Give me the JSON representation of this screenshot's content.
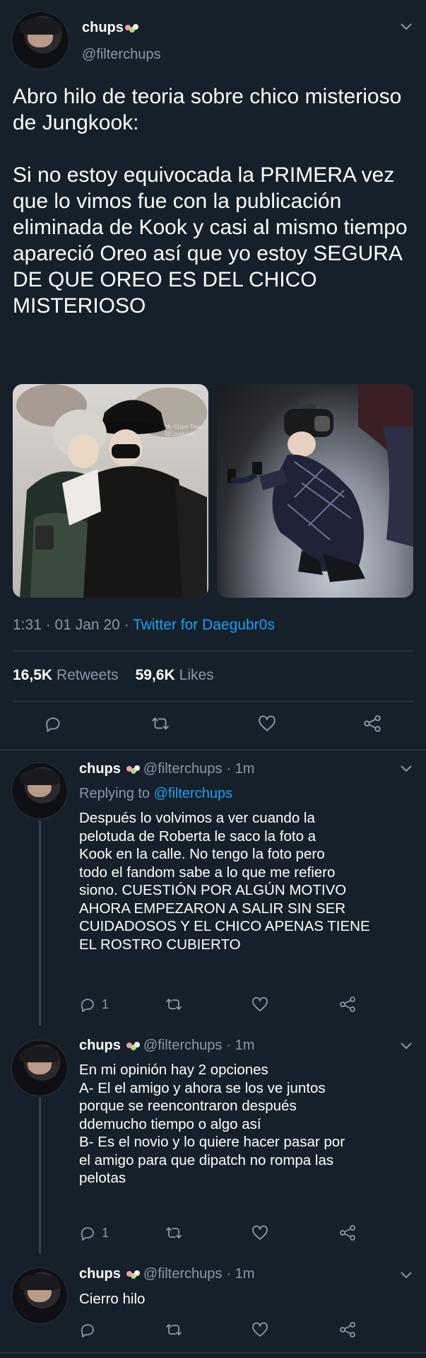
{
  "main_tweet": {
    "display_name": "chups",
    "handle": "@filterchups",
    "text": "Abro hilo de teoria sobre chico misterioso de Jungkook:\n\nSi no estoy equivocada la PRIMERA vez que lo vimos fue con la publicación eliminada de Kook y casi al mismo tiempo apareció Oreo así que yo estoy SEGURA DE QUE OREO ES DEL CHICO MISTERIOSO",
    "timestamp": "1:31 · 01 Jan 20 · ",
    "source": "Twitter for Daegubr0s",
    "retweets_count": "16,5K",
    "retweets_label": "Retweets",
    "likes_count": "59,6K",
    "likes_label": "Likes",
    "image_watermark": "My Chips Toss\n@Lovelovin"
  },
  "replies": [
    {
      "display_name": "chups",
      "handle": "@filterchups",
      "time": "· 1m",
      "replying_label": "Replying to",
      "replying_handle": "@filterchups",
      "text": "Después lo volvimos a ver cuando la\npelotuda de Roberta le saco la foto a\nKook en la calle. No tengo la foto pero\ntodo el fandom sabe a lo que me refiero\nsiono. CUESTIÓN POR ALGÚN MOTIVO\nAHORA EMPEZARON A SALIR SIN SER\nCUIDADOSOS Y EL CHICO APENAS TIENE\nEL ROSTRO CUBIERTO",
      "reply_count": "1"
    },
    {
      "display_name": "chups",
      "handle": "@filterchups",
      "time": "· 1m",
      "text": "En mi opinión hay 2 opciones\nA- El el amigo y ahora se los ve juntos\nporque se reencontraron después\nddemucho tiempo o algo así\nB- Es el novio y lo quiere hacer pasar por\nel amigo para que dipatch no rompa las\npelotas",
      "reply_count": "1"
    },
    {
      "display_name": "chups",
      "handle": "@filterchups",
      "time": "· 1m",
      "text": "Cierro hilo",
      "reply_count": ""
    }
  ],
  "icons": {
    "reply": "reply-icon",
    "retweet": "retweet-icon",
    "like": "like-icon",
    "share": "share-icon",
    "caret": "chevron-down-icon"
  },
  "colors": {
    "background": "#15202b",
    "accent": "#1da1f2",
    "muted": "#8899a6",
    "divider": "#38444d"
  }
}
